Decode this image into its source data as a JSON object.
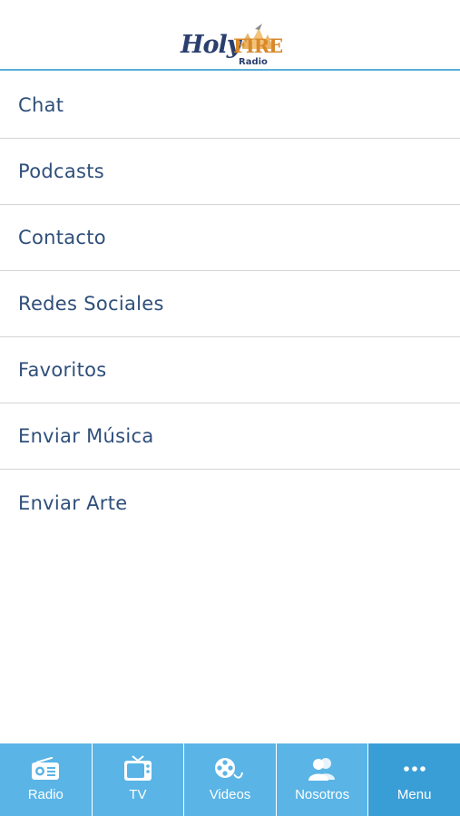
{
  "header": {
    "logo_holy": "Holy",
    "logo_fire": "FIRE",
    "logo_radio": "Radio"
  },
  "menu": {
    "items": [
      {
        "label": "Chat"
      },
      {
        "label": "Podcasts"
      },
      {
        "label": "Contacto"
      },
      {
        "label": "Redes Sociales"
      },
      {
        "label": "Favoritos"
      },
      {
        "label": "Enviar Música"
      },
      {
        "label": "Enviar Arte"
      }
    ]
  },
  "tabbar": {
    "tabs": [
      {
        "label": "Radio",
        "icon": "radio-icon"
      },
      {
        "label": "TV",
        "icon": "tv-icon"
      },
      {
        "label": "Videos",
        "icon": "film-reel-icon"
      },
      {
        "label": "Nosotros",
        "icon": "people-icon"
      },
      {
        "label": "Menu",
        "icon": "more-dots-icon",
        "active": true
      }
    ]
  },
  "colors": {
    "accent": "#5ab4e6",
    "accent_active": "#3a9ed6",
    "text": "#2f4f7a",
    "divider": "#d4d4d4"
  }
}
